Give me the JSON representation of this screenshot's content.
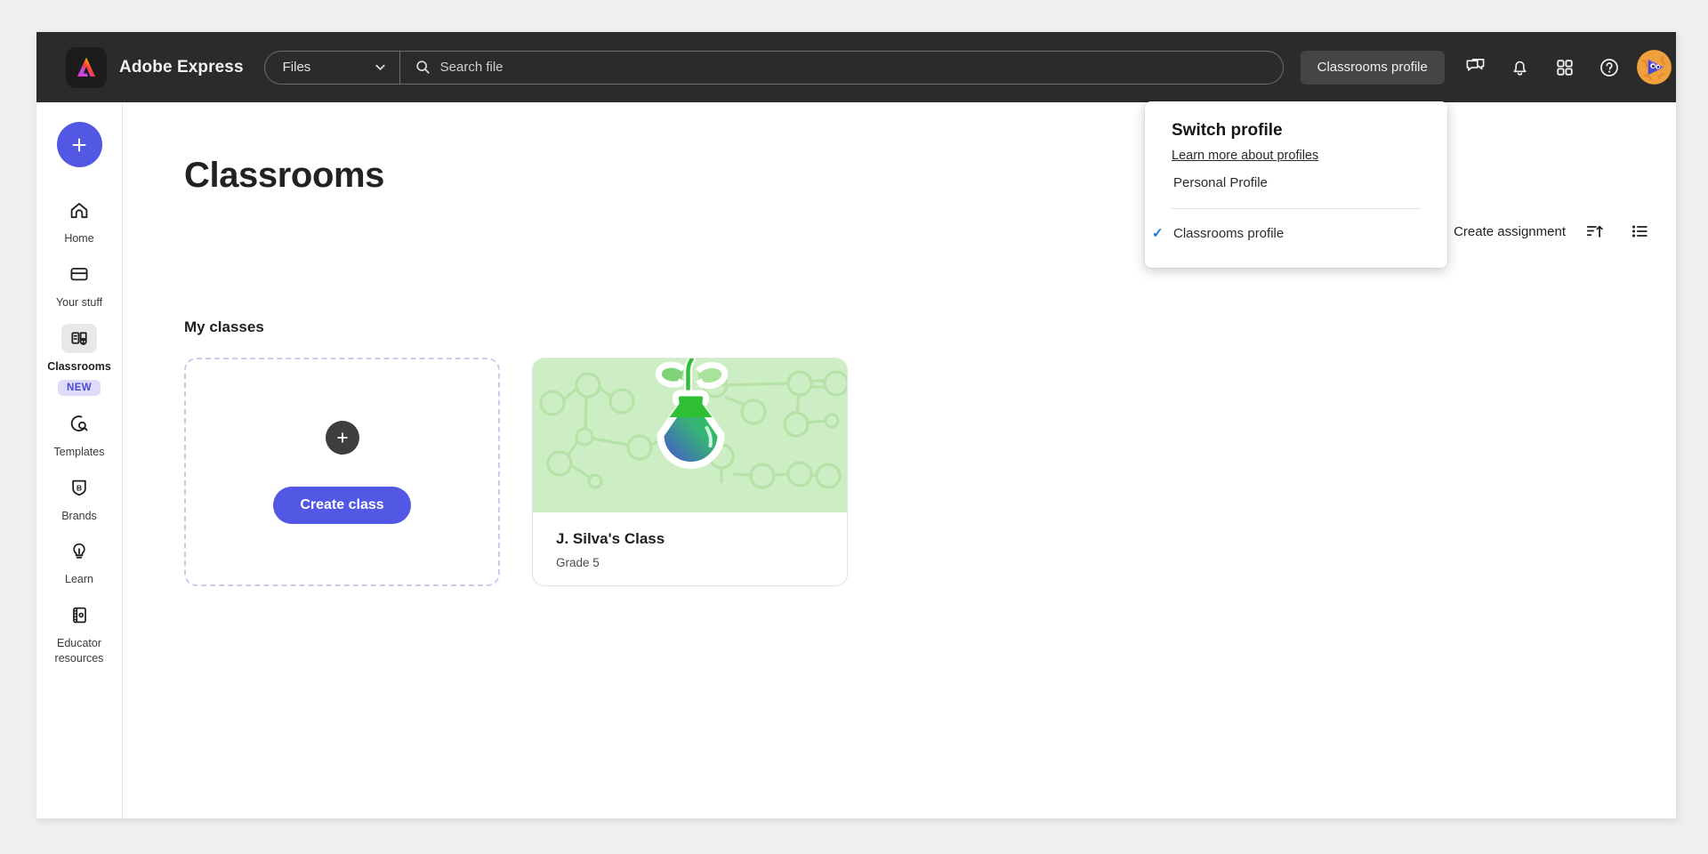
{
  "header": {
    "brand_name": "Adobe Express",
    "logo_icon": "adobe-express-logo-icon",
    "files_select_value": "Files",
    "files_select_chevron": "chevron-down-icon",
    "search_icon": "search-icon",
    "search_placeholder": "Search file",
    "profile_chip_label": "Classrooms profile",
    "icons": [
      {
        "name": "chat-icon",
        "label": "Chat"
      },
      {
        "name": "bell-icon",
        "label": "Notifications"
      },
      {
        "name": "apps-grid-icon",
        "label": "Apps"
      },
      {
        "name": "help-circle-icon",
        "label": "Help"
      }
    ],
    "avatar_name": "user-avatar"
  },
  "sidebar": {
    "create_button_icon": "plus-icon",
    "items": [
      {
        "label": "Home",
        "icon": "home-icon",
        "active": false,
        "badge": null
      },
      {
        "label": "Your stuff",
        "icon": "folder-icon",
        "active": false,
        "badge": null
      },
      {
        "label": "Classrooms",
        "icon": "classrooms-icon",
        "active": true,
        "badge": "NEW"
      },
      {
        "label": "Templates",
        "icon": "templates-search-icon",
        "active": false,
        "badge": null
      },
      {
        "label": "Brands",
        "icon": "brands-shield-icon",
        "active": false,
        "badge": null
      },
      {
        "label": "Learn",
        "icon": "lightbulb-icon",
        "active": false,
        "badge": null
      },
      {
        "label": "Educator resources",
        "icon": "notebook-icon",
        "active": false,
        "badge": null
      }
    ]
  },
  "main": {
    "page_title": "Classrooms",
    "section_heading": "My classes",
    "create_assignment_label": "Create assignment",
    "sort_icon": "sort-ascending-icon",
    "view_icon": "list-view-icon",
    "create_card": {
      "plus_icon": "plus-icon",
      "button_label": "Create class"
    },
    "classes": [
      {
        "name": "J. Silva's Class",
        "grade": "Grade 5",
        "thumbnail_icon": "science-flask-sprout-icon",
        "thumbnail_bg": "#cdeec4"
      }
    ]
  },
  "profile_dropdown": {
    "title": "Switch profile",
    "learn_more_label": "Learn more about profiles",
    "options": [
      {
        "label": "Personal Profile",
        "selected": false
      },
      {
        "label": "Classrooms profile",
        "selected": true
      }
    ],
    "check_icon": "check-icon",
    "check_color": "#1473e6"
  },
  "colors": {
    "header_bg": "#2b2b2b",
    "accent_indigo": "#5258e4",
    "badge_bg": "#dedcf9",
    "badge_text": "#4a49d6",
    "page_bg": "#efefef"
  }
}
